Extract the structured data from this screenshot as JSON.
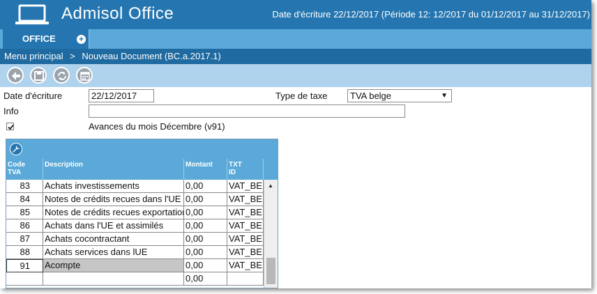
{
  "header": {
    "app_title": "Admisol Office",
    "date_info": "Date d'écriture 22/12/2017 (Période 12: 12/2017 du 01/12/2017 au 31/12/2017)",
    "icon": "laptop-icon"
  },
  "tabs": [
    {
      "label": "OFFICE",
      "add_icon": "+"
    }
  ],
  "breadcrumb": {
    "items": [
      "Menu principal",
      ">",
      "Nouveau Document (BC.a.2017.1)"
    ]
  },
  "toolbar": {
    "buttons": [
      "back-icon",
      "save-icon",
      "refresh-icon",
      "calendar-icon"
    ]
  },
  "form": {
    "date_label": "Date d'écriture",
    "date_value": "22/12/2017",
    "tax_label": "Type de taxe",
    "tax_value": "TVA belge",
    "info_label": "Info",
    "info_value": "",
    "checkbox_checked": true,
    "checkbox_label": "Avances du mois Décembre (v91)"
  },
  "grid": {
    "columns": [
      {
        "line1": "Code",
        "line2": "TVA"
      },
      {
        "line1": "Description",
        "line2": ""
      },
      {
        "line1": "Montant",
        "line2": ""
      },
      {
        "line1": "TXT",
        "line2": "ID"
      }
    ],
    "rows": [
      {
        "code": "83",
        "description": "Achats investissements",
        "montant": "0,00",
        "txt": "VAT_BE"
      },
      {
        "code": "84",
        "description": "Notes de crédits recues dans l'UE",
        "montant": "0,00",
        "txt": "VAT_BE"
      },
      {
        "code": "85",
        "description": "Notes de crédits recues exportations",
        "montant": "0,00",
        "txt": "VAT_BE"
      },
      {
        "code": "86",
        "description": "Achats dans l'UE et assimilés",
        "montant": "0,00",
        "txt": "VAT_BE"
      },
      {
        "code": "87",
        "description": "Achats cocontractant",
        "montant": "0,00",
        "txt": "VAT_BE"
      },
      {
        "code": "88",
        "description": "Achats services dans lUE",
        "montant": "0,00",
        "txt": "VAT_BE"
      },
      {
        "code": "91",
        "description": "Acompte",
        "montant": "0,00",
        "txt": "VAT_BE"
      },
      {
        "code": "",
        "description": "",
        "montant": "0,00",
        "txt": ""
      }
    ]
  },
  "colors": {
    "header_blue": "#2576b0",
    "tab_bar": "#5aa9d8",
    "breadcrumb": "#1f6aa0",
    "toolbar": "#afd3ec",
    "selected_row": "#c6c6c6"
  }
}
